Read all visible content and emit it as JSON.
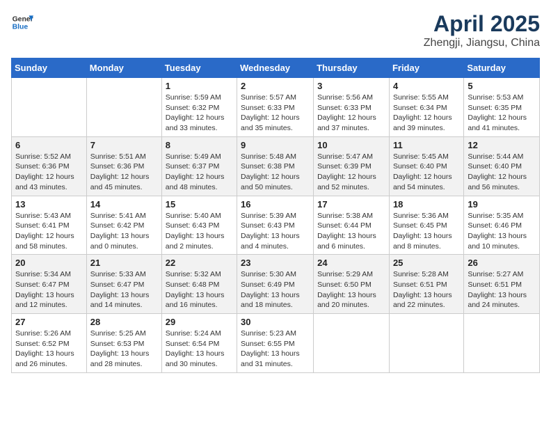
{
  "header": {
    "logo_general": "General",
    "logo_blue": "Blue",
    "month_year": "April 2025",
    "location": "Zhengji, Jiangsu, China"
  },
  "days_of_week": [
    "Sunday",
    "Monday",
    "Tuesday",
    "Wednesday",
    "Thursday",
    "Friday",
    "Saturday"
  ],
  "weeks": [
    [
      {
        "day": "",
        "content": ""
      },
      {
        "day": "",
        "content": ""
      },
      {
        "day": "1",
        "content": "Sunrise: 5:59 AM\nSunset: 6:32 PM\nDaylight: 12 hours and 33 minutes."
      },
      {
        "day": "2",
        "content": "Sunrise: 5:57 AM\nSunset: 6:33 PM\nDaylight: 12 hours and 35 minutes."
      },
      {
        "day": "3",
        "content": "Sunrise: 5:56 AM\nSunset: 6:33 PM\nDaylight: 12 hours and 37 minutes."
      },
      {
        "day": "4",
        "content": "Sunrise: 5:55 AM\nSunset: 6:34 PM\nDaylight: 12 hours and 39 minutes."
      },
      {
        "day": "5",
        "content": "Sunrise: 5:53 AM\nSunset: 6:35 PM\nDaylight: 12 hours and 41 minutes."
      }
    ],
    [
      {
        "day": "6",
        "content": "Sunrise: 5:52 AM\nSunset: 6:36 PM\nDaylight: 12 hours and 43 minutes."
      },
      {
        "day": "7",
        "content": "Sunrise: 5:51 AM\nSunset: 6:36 PM\nDaylight: 12 hours and 45 minutes."
      },
      {
        "day": "8",
        "content": "Sunrise: 5:49 AM\nSunset: 6:37 PM\nDaylight: 12 hours and 48 minutes."
      },
      {
        "day": "9",
        "content": "Sunrise: 5:48 AM\nSunset: 6:38 PM\nDaylight: 12 hours and 50 minutes."
      },
      {
        "day": "10",
        "content": "Sunrise: 5:47 AM\nSunset: 6:39 PM\nDaylight: 12 hours and 52 minutes."
      },
      {
        "day": "11",
        "content": "Sunrise: 5:45 AM\nSunset: 6:40 PM\nDaylight: 12 hours and 54 minutes."
      },
      {
        "day": "12",
        "content": "Sunrise: 5:44 AM\nSunset: 6:40 PM\nDaylight: 12 hours and 56 minutes."
      }
    ],
    [
      {
        "day": "13",
        "content": "Sunrise: 5:43 AM\nSunset: 6:41 PM\nDaylight: 12 hours and 58 minutes."
      },
      {
        "day": "14",
        "content": "Sunrise: 5:41 AM\nSunset: 6:42 PM\nDaylight: 13 hours and 0 minutes."
      },
      {
        "day": "15",
        "content": "Sunrise: 5:40 AM\nSunset: 6:43 PM\nDaylight: 13 hours and 2 minutes."
      },
      {
        "day": "16",
        "content": "Sunrise: 5:39 AM\nSunset: 6:43 PM\nDaylight: 13 hours and 4 minutes."
      },
      {
        "day": "17",
        "content": "Sunrise: 5:38 AM\nSunset: 6:44 PM\nDaylight: 13 hours and 6 minutes."
      },
      {
        "day": "18",
        "content": "Sunrise: 5:36 AM\nSunset: 6:45 PM\nDaylight: 13 hours and 8 minutes."
      },
      {
        "day": "19",
        "content": "Sunrise: 5:35 AM\nSunset: 6:46 PM\nDaylight: 13 hours and 10 minutes."
      }
    ],
    [
      {
        "day": "20",
        "content": "Sunrise: 5:34 AM\nSunset: 6:47 PM\nDaylight: 13 hours and 12 minutes."
      },
      {
        "day": "21",
        "content": "Sunrise: 5:33 AM\nSunset: 6:47 PM\nDaylight: 13 hours and 14 minutes."
      },
      {
        "day": "22",
        "content": "Sunrise: 5:32 AM\nSunset: 6:48 PM\nDaylight: 13 hours and 16 minutes."
      },
      {
        "day": "23",
        "content": "Sunrise: 5:30 AM\nSunset: 6:49 PM\nDaylight: 13 hours and 18 minutes."
      },
      {
        "day": "24",
        "content": "Sunrise: 5:29 AM\nSunset: 6:50 PM\nDaylight: 13 hours and 20 minutes."
      },
      {
        "day": "25",
        "content": "Sunrise: 5:28 AM\nSunset: 6:51 PM\nDaylight: 13 hours and 22 minutes."
      },
      {
        "day": "26",
        "content": "Sunrise: 5:27 AM\nSunset: 6:51 PM\nDaylight: 13 hours and 24 minutes."
      }
    ],
    [
      {
        "day": "27",
        "content": "Sunrise: 5:26 AM\nSunset: 6:52 PM\nDaylight: 13 hours and 26 minutes."
      },
      {
        "day": "28",
        "content": "Sunrise: 5:25 AM\nSunset: 6:53 PM\nDaylight: 13 hours and 28 minutes."
      },
      {
        "day": "29",
        "content": "Sunrise: 5:24 AM\nSunset: 6:54 PM\nDaylight: 13 hours and 30 minutes."
      },
      {
        "day": "30",
        "content": "Sunrise: 5:23 AM\nSunset: 6:55 PM\nDaylight: 13 hours and 31 minutes."
      },
      {
        "day": "",
        "content": ""
      },
      {
        "day": "",
        "content": ""
      },
      {
        "day": "",
        "content": ""
      }
    ]
  ]
}
